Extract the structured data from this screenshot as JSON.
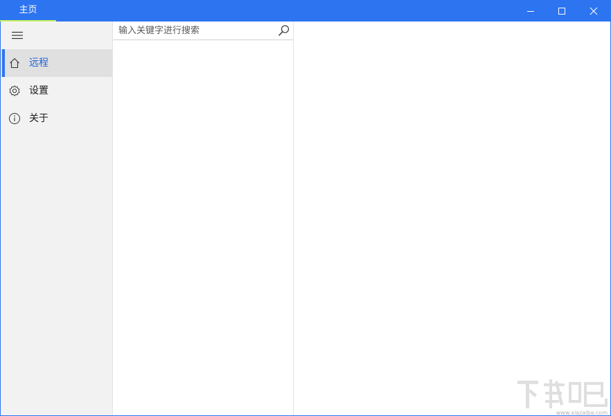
{
  "titlebar": {
    "tab_label": "主页",
    "bg_color": "#2d74f0",
    "accent_underline": "#c9f45c",
    "buttons": {
      "minimize": "minimize-icon",
      "maximize": "maximize-icon",
      "close": "close-icon"
    }
  },
  "sidebar": {
    "menu_icon": "hamburger-icon",
    "items": [
      {
        "label": "远程",
        "icon": "home-icon",
        "active": true
      },
      {
        "label": "设置",
        "icon": "gear-icon",
        "active": false
      },
      {
        "label": "关于",
        "icon": "info-icon",
        "active": false
      }
    ]
  },
  "search": {
    "placeholder": "输入关键字进行搜索",
    "value": "",
    "icon": "search-icon"
  },
  "watermark": {
    "text": "下载吧",
    "url": "www.xiazaiba.com"
  }
}
